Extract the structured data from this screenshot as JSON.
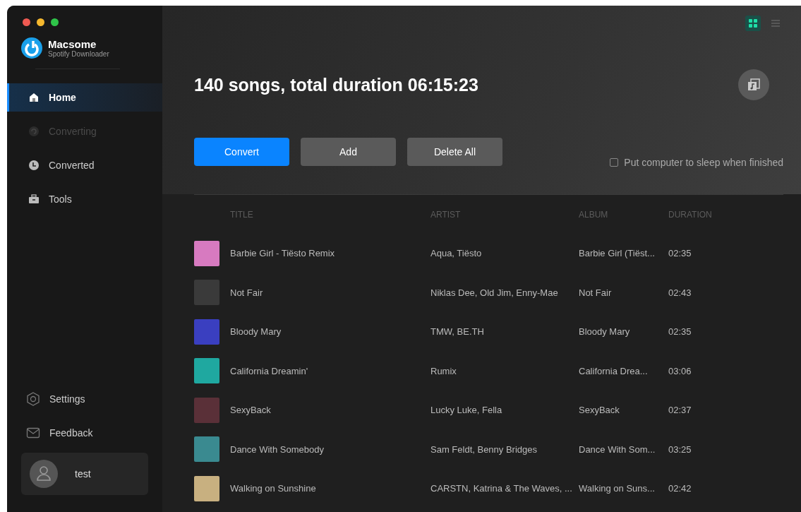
{
  "app": {
    "name": "Macsome",
    "subtitle": "Spotify Downloader"
  },
  "nav": [
    {
      "label": "Home",
      "kind": "home",
      "selected": true,
      "disabled": false
    },
    {
      "label": "Converting",
      "kind": "converting",
      "selected": false,
      "disabled": true
    },
    {
      "label": "Converted",
      "kind": "clock",
      "selected": false,
      "disabled": false
    },
    {
      "label": "Tools",
      "kind": "toolbox",
      "selected": false,
      "disabled": false
    }
  ],
  "bottom_nav": [
    {
      "label": "Settings",
      "kind": "gear"
    },
    {
      "label": "Feedback",
      "kind": "mail"
    }
  ],
  "user": {
    "name": "test"
  },
  "view_toggle": [
    {
      "kind": "grid",
      "selected": true
    },
    {
      "kind": "list",
      "selected": false
    }
  ],
  "summary": "140 songs, total duration 06:15:23",
  "buttons": [
    {
      "label": "Convert",
      "kind": "primary"
    },
    {
      "label": "Add",
      "kind": "secondary"
    },
    {
      "label": "Delete All",
      "kind": "secondary"
    }
  ],
  "sleep_option": {
    "label": "Put computer to sleep when finished",
    "checked": false
  },
  "table": {
    "columns": [
      "TITLE",
      "ARTIST",
      "ALBUM",
      "DURATION"
    ],
    "rows": [
      {
        "title": "Barbie Girl - Tiësto Remix",
        "artist": "Aqua, Tiësto",
        "album": "Barbie Girl (Tiëst...",
        "duration": "02:35",
        "color": "#d77ac0"
      },
      {
        "title": "Not Fair",
        "artist": "Niklas Dee, Old Jim, Enny-Mae",
        "album": "Not Fair",
        "duration": "02:43",
        "color": "#3a3a3a"
      },
      {
        "title": "Bloody Mary",
        "artist": "TMW, BE.TH",
        "album": "Bloody Mary",
        "duration": "02:35",
        "color": "#3a3fc0"
      },
      {
        "title": "California Dreamin'",
        "artist": "Rumix",
        "album": "California Drea...",
        "duration": "03:06",
        "color": "#1fa8a0"
      },
      {
        "title": "SexyBack",
        "artist": "Lucky Luke, Fella",
        "album": "SexyBack",
        "duration": "02:37",
        "color": "#5a3038"
      },
      {
        "title": "Dance With Somebody",
        "artist": "Sam Feldt, Benny Bridges",
        "album": "Dance With Som...",
        "duration": "03:25",
        "color": "#3a8a90"
      },
      {
        "title": "Walking on Sunshine",
        "artist": "CARSTN, Katrina & The Waves, ...",
        "album": "Walking on Suns...",
        "duration": "02:42",
        "color": "#c8b080"
      }
    ]
  }
}
